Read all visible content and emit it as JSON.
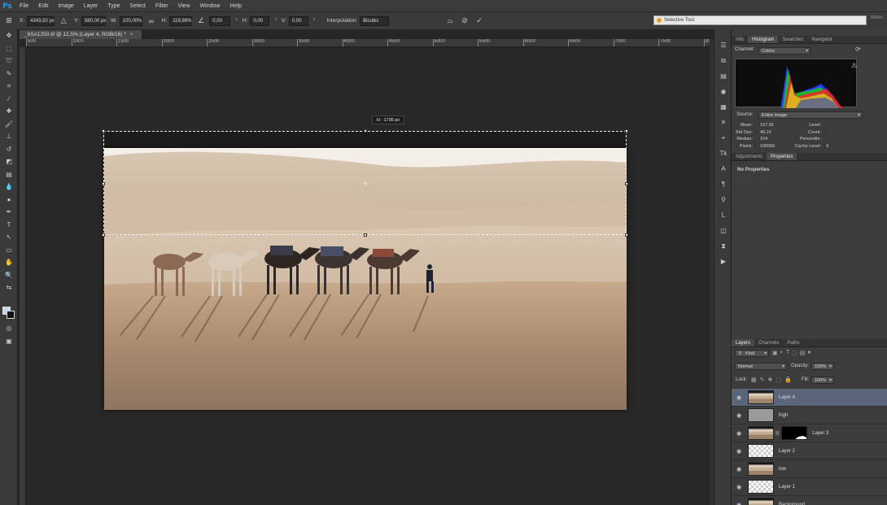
{
  "app": {
    "logo": "Ps"
  },
  "menu": [
    "File",
    "Edit",
    "Image",
    "Layer",
    "Type",
    "Select",
    "Filter",
    "View",
    "Window",
    "Help"
  ],
  "options": {
    "x_label": "X:",
    "x_value": "4343,50 px",
    "y_label": "Y:",
    "y_value": "580,00 px",
    "w_label": "W:",
    "w_value": "100,00%",
    "h_label": "H:",
    "h_value": "119,89%",
    "angle_value": "0,00",
    "hskew_label": "H:",
    "hskew_value": "0,00",
    "vskew_label": "V:",
    "vskew_value": "0,00",
    "interp_label": "Interpolation:",
    "interp_value": "Bicubic",
    "deg": "°"
  },
  "search": {
    "text": "Selective Tool"
  },
  "workspace": {
    "label": "hbres"
  },
  "document": {
    "tab_title": "_6SA1250.tif @ 12,5% (Layer 4, RGB/16) *",
    "hud_text": "H : 1736 px"
  },
  "ruler_top": [
    "500",
    "1000",
    "1500",
    "2000",
    "2500",
    "3000",
    "3500",
    "4000",
    "4500",
    "5000",
    "5500",
    "6000",
    "6500",
    "7000",
    "7500",
    "8000"
  ],
  "histogram_panel": {
    "tabs": [
      "Info",
      "Histogram",
      "Swatches",
      "Navigator"
    ],
    "active_tab": "Histogram",
    "channel_label": "Channel:",
    "channel_value": "Colors",
    "source_label": "Source:",
    "source_value": "Entire Image",
    "stats_left": [
      {
        "label": "Mean:",
        "value": "157,92"
      },
      {
        "label": "Std Dev:",
        "value": "40,15"
      },
      {
        "label": "Median:",
        "value": "154"
      },
      {
        "label": "Pixels:",
        "value": "196566"
      }
    ],
    "stats_right": [
      {
        "label": "Level:",
        "value": ""
      },
      {
        "label": "Count:",
        "value": ""
      },
      {
        "label": "Percentile:",
        "value": ""
      },
      {
        "label": "Cache Level:",
        "value": "4"
      }
    ]
  },
  "properties_panel": {
    "tabs": [
      "Adjustments",
      "Properties"
    ],
    "active_tab": "Properties",
    "message": "No Properties"
  },
  "layers_panel": {
    "tabs": [
      "Layers",
      "Channels",
      "Paths"
    ],
    "active_tab": "Layers",
    "kind_label": "Kind",
    "blend_mode": "Normal",
    "opacity_label": "Opacity:",
    "opacity_value": "100%",
    "lock_label": "Lock:",
    "fill_label": "Fill:",
    "fill_value": "100%",
    "layers": [
      {
        "name": "Layer 4",
        "thumb": "photo",
        "selected": true,
        "mask": false
      },
      {
        "name": "high",
        "thumb": "gray",
        "selected": false,
        "mask": false
      },
      {
        "name": "Layer 3",
        "thumb": "photo",
        "selected": false,
        "mask": true
      },
      {
        "name": "Layer 2",
        "thumb": "check",
        "selected": false,
        "mask": false
      },
      {
        "name": "low",
        "thumb": "photo",
        "selected": false,
        "mask": false
      },
      {
        "name": "Layer 1",
        "thumb": "check",
        "selected": false,
        "mask": false
      },
      {
        "name": "Background",
        "thumb": "photo",
        "selected": false,
        "mask": false
      }
    ]
  }
}
